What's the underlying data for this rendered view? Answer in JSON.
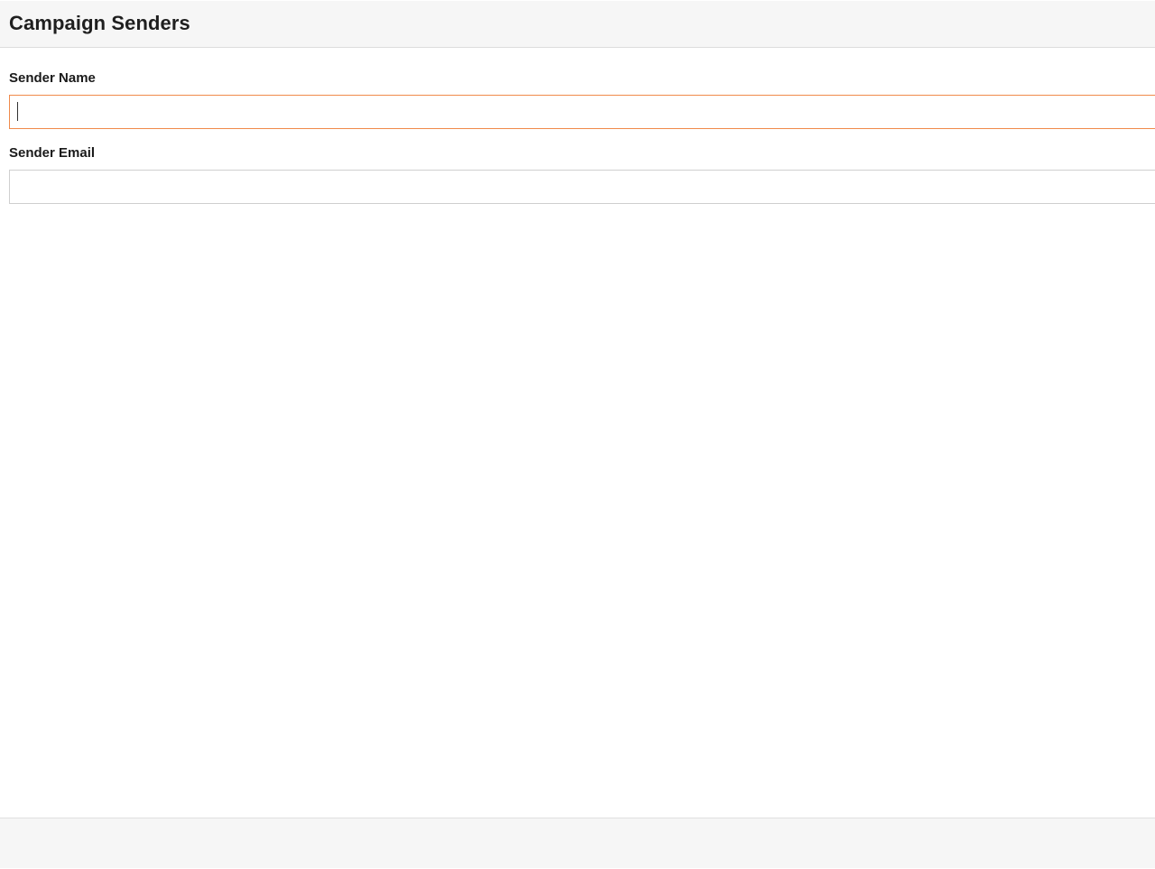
{
  "header": {
    "title": "Campaign Senders"
  },
  "form": {
    "sender_name": {
      "label": "Sender Name",
      "value": "",
      "placeholder": "",
      "focused": true
    },
    "sender_email": {
      "label": "Sender Email",
      "value": "",
      "placeholder": ""
    }
  },
  "colors": {
    "header_background": "#f6f6f6",
    "focus_border": "#f08a4b",
    "input_border": "#cfcfcf",
    "footer_background": "#f6f6f6"
  }
}
